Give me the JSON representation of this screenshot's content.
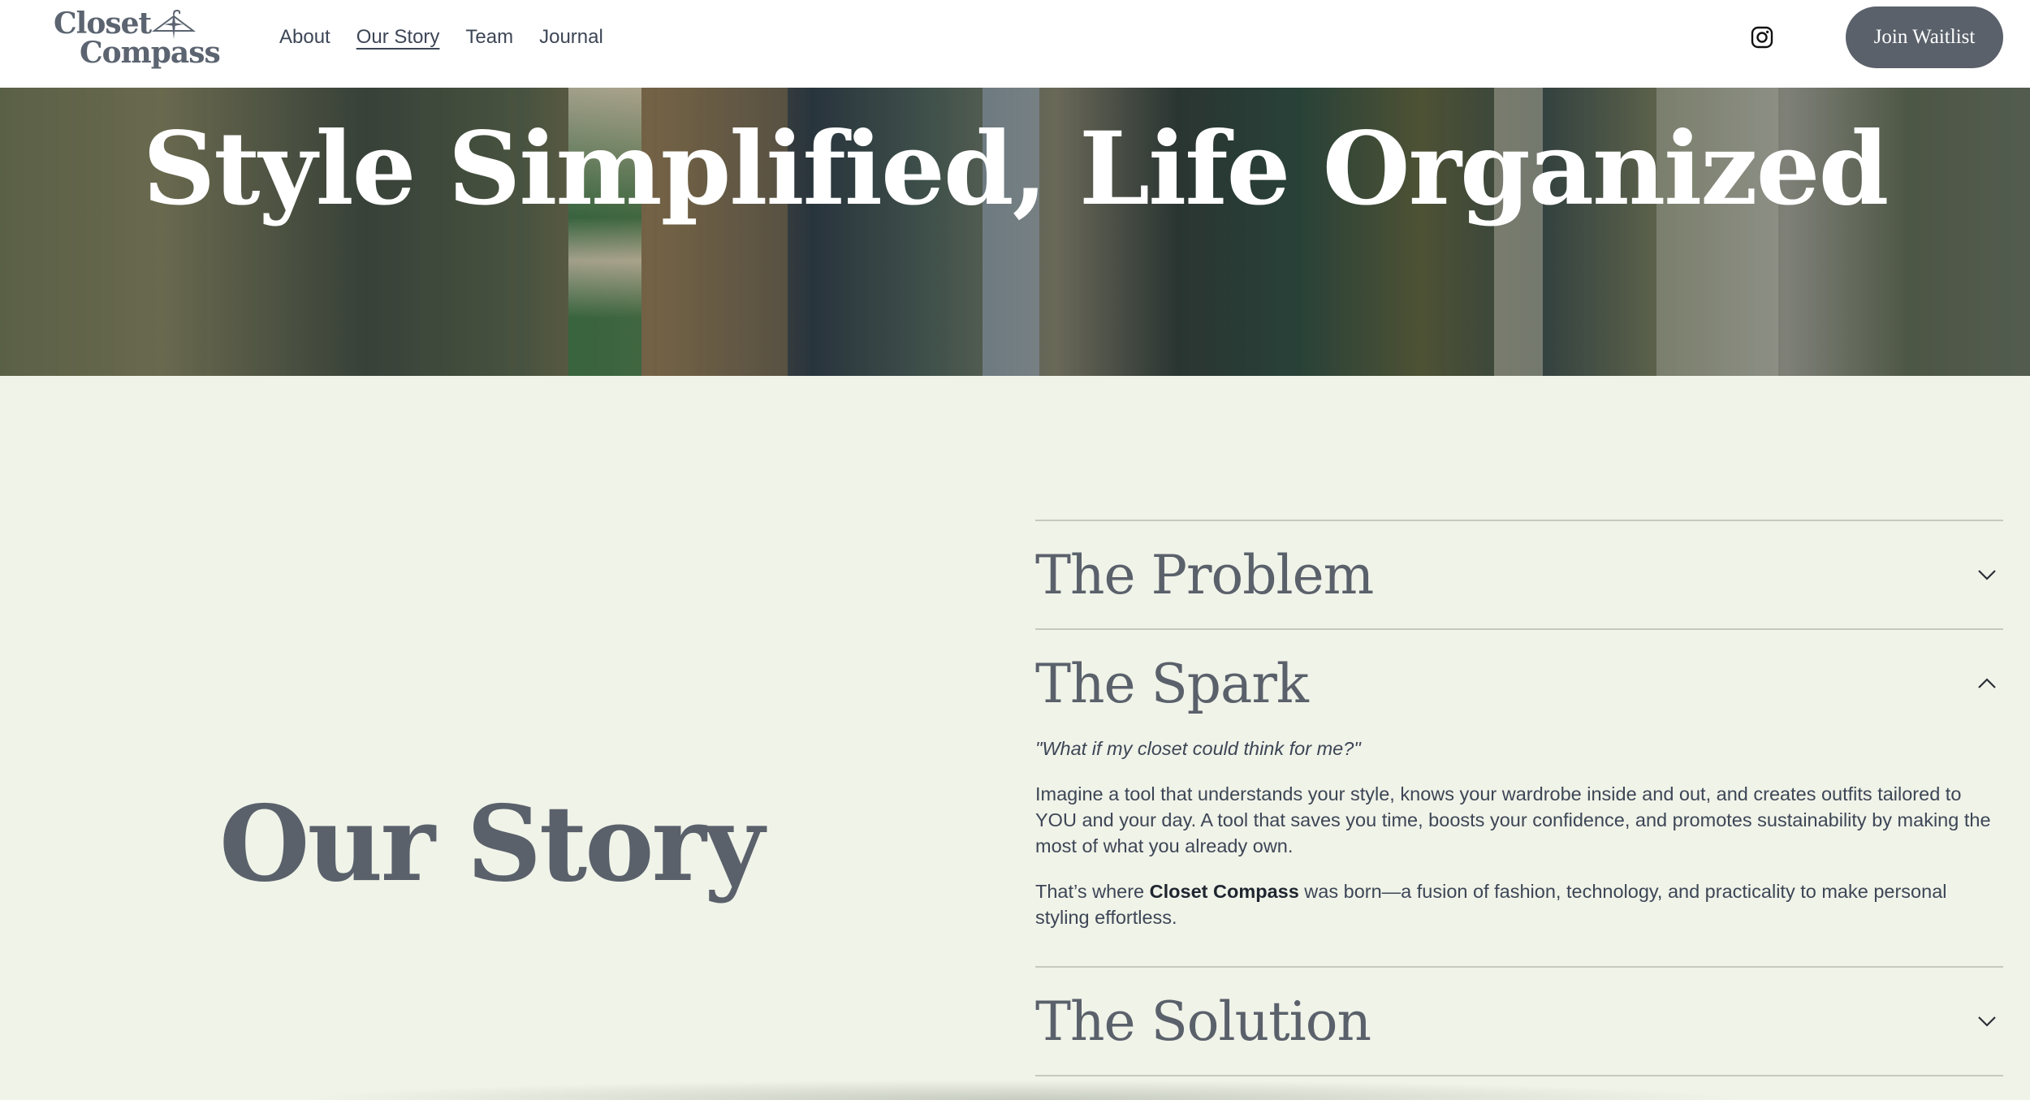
{
  "header": {
    "logo": {
      "line1": "Closet",
      "line2": "Compass"
    },
    "nav": [
      {
        "label": "About",
        "active": false
      },
      {
        "label": "Our Story",
        "active": true
      },
      {
        "label": "Team",
        "active": false
      },
      {
        "label": "Journal",
        "active": false
      }
    ],
    "instagram_icon": "instagram-icon",
    "cta_label": "Join Waitlist"
  },
  "hero": {
    "title": "Style Simplified, Life Organized"
  },
  "section": {
    "heading": "Our Story",
    "accordion": [
      {
        "title": "The Problem",
        "expanded": false,
        "icon": "chevron-down-icon"
      },
      {
        "title": "The Spark",
        "expanded": true,
        "icon": "chevron-up-icon",
        "quote": "\"What if my closet could think for me?\"",
        "paragraph1": "Imagine a tool that understands your style, knows your wardrobe inside and out, and creates outfits tailored to YOU and your day. A tool that saves you time, boosts your confidence, and promotes sustainability by making the most of what you already own.",
        "paragraph2_before": "That’s where ",
        "paragraph2_bold": "Closet Compass",
        "paragraph2_after": " was born—a fusion of fashion, technology, and practicality to make personal styling effortless."
      },
      {
        "title": "The Solution",
        "expanded": false,
        "icon": "chevron-down-icon"
      }
    ]
  },
  "colors": {
    "background": "#f0f3e8",
    "button": "#5a616b",
    "heading": "#5a616b",
    "text": "#3d4656"
  }
}
